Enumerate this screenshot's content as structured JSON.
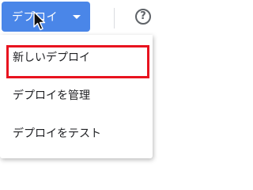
{
  "header": {
    "deploy_label": "デプロイ",
    "dropdown_icon": "caret-down-icon",
    "help_icon": "help-circle-icon",
    "help_glyph": "?"
  },
  "menu": {
    "items": [
      {
        "label": "新しいデプロイ"
      },
      {
        "label": "デプロイを管理"
      },
      {
        "label": "デプロイをテスト"
      }
    ]
  },
  "colors": {
    "deploy_button": "#4a86e8",
    "highlight_border": "#e8131f"
  }
}
